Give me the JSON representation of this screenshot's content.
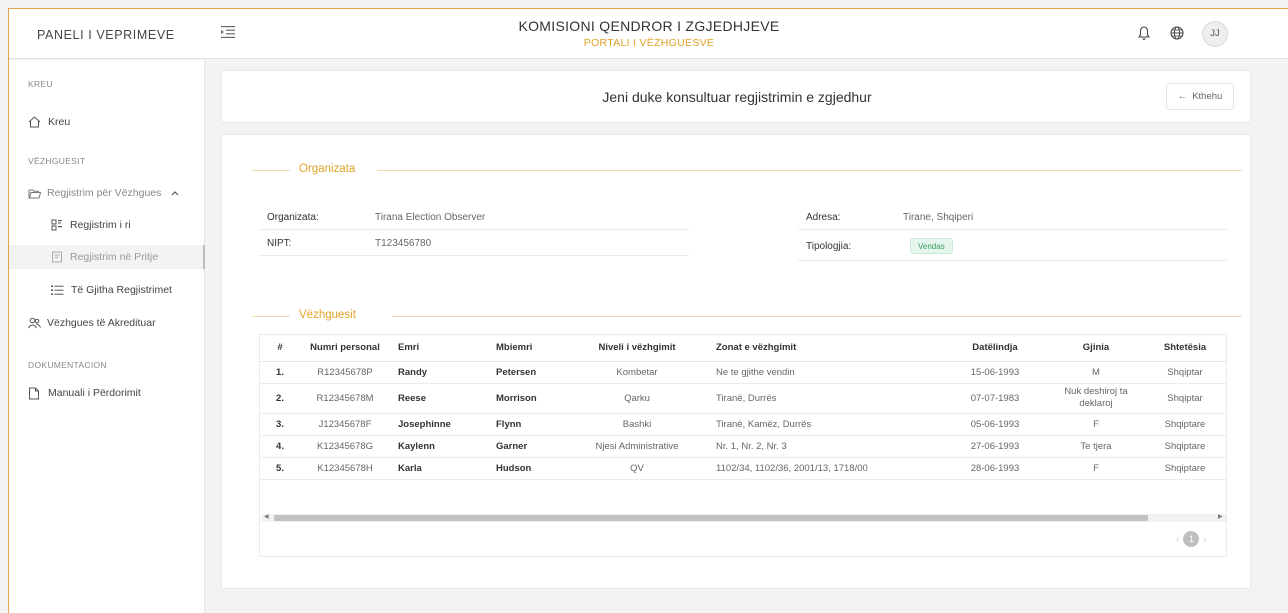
{
  "header": {
    "brand": "PANELI I VEPRIMEVE",
    "title": "KOMISIONI QENDROR I ZGJEDHJEVE",
    "subtitle": "PORTALI I VËZHGUESVE",
    "avatar": "JJ",
    "icons": [
      "menu-toggle-icon",
      "bell-icon",
      "globe-icon"
    ],
    "accent_color": "#e0a227"
  },
  "sidebar": {
    "section_kreu": "KREU",
    "kreu": "Kreu",
    "section_vezhguesit": "VËZHGUESIT",
    "registration_group": "Regjistrim për Vëzhgues",
    "new_registration": "Regjistrim i ri",
    "pending_registration": "Regjistrim në Pritje",
    "all_registrations": "Të Gjitha Regjistrimet",
    "accredited": "Vëzhgues të Akredituar",
    "section_doc": "DOKUMENTACION",
    "manual": "Manuali i Përdorimit"
  },
  "page": {
    "heading": "Jeni duke konsultuar regjistrimin e zgjedhur",
    "back_label": "Kthehu"
  },
  "organization": {
    "section_title": "Organizata",
    "name_label": "Organizata:",
    "name_value": "Tirana Election Observer",
    "nipt_label": "NIPT:",
    "nipt_value": "T123456780",
    "address_label": "Adresa:",
    "address_value": "Tirane, Shqiperi",
    "type_label": "Tipologjia:",
    "type_value": "Vendas"
  },
  "observers": {
    "section_title": "Vëzhguesit",
    "columns": [
      "#",
      "Numri personal",
      "Emri",
      "Mbiemri",
      "Niveli i vëzhgimit",
      "Zonat e vëzhgimit",
      "Datëlindja",
      "Gjinia",
      "Shtetësia"
    ],
    "rows": [
      {
        "no": "1.",
        "pid": "R12345678P",
        "first": "Randy",
        "last": "Petersen",
        "level": "Kombetar",
        "zones": "Ne te gjithe vendin",
        "dob": "15-06-1993",
        "gender": "M",
        "nationality": "Shqiptar"
      },
      {
        "no": "2.",
        "pid": "R12345678M",
        "first": "Reese",
        "last": "Morrison",
        "level": "Qarku",
        "zones": "Tiranë, Durrës",
        "dob": "07-07-1983",
        "gender": "Nuk deshiroj ta deklaroj",
        "nationality": "Shqiptar"
      },
      {
        "no": "3.",
        "pid": "J12345678F",
        "first": "Josephinne",
        "last": "Flynn",
        "level": "Bashki",
        "zones": "Tiranë, Kamëz, Durrës",
        "dob": "05-06-1993",
        "gender": "F",
        "nationality": "Shqiptare"
      },
      {
        "no": "4.",
        "pid": "K12345678G",
        "first": "Kaylenn",
        "last": "Garner",
        "level": "Njesi Administrative",
        "zones": "Nr. 1, Nr. 2, Nr. 3",
        "dob": "27-06-1993",
        "gender": "Te tjera",
        "nationality": "Shqiptare"
      },
      {
        "no": "5.",
        "pid": "K12345678H",
        "first": "Karla",
        "last": "Hudson",
        "level": "QV",
        "zones": "1102/34, 1102/36, 2001/13, 1718/00",
        "dob": "28-06-1993",
        "gender": "F",
        "nationality": "Shqiptare"
      }
    ],
    "current_page": "1"
  }
}
